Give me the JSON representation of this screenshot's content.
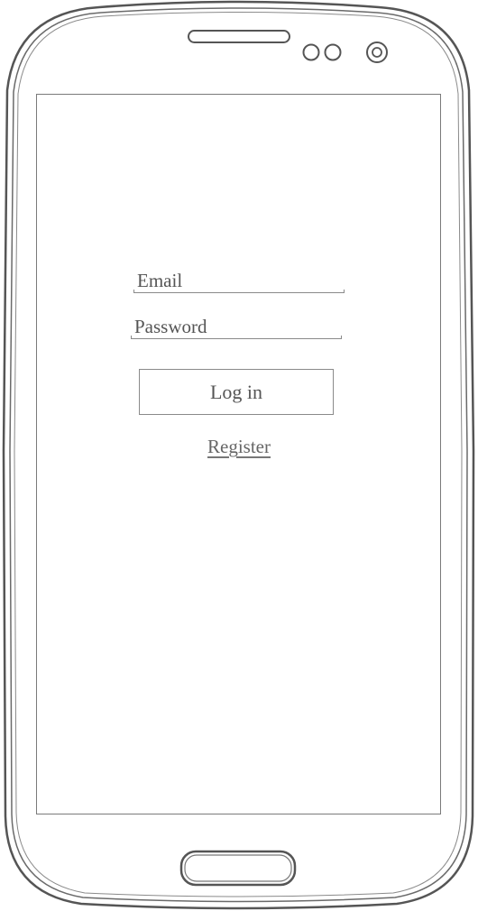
{
  "login_form": {
    "email_label": "Email",
    "password_label": "Password",
    "login_button_label": "Log in",
    "register_link_label": "Register"
  },
  "device": {
    "frame_color": "#555555",
    "screen_border_color": "#7a7a7a"
  }
}
